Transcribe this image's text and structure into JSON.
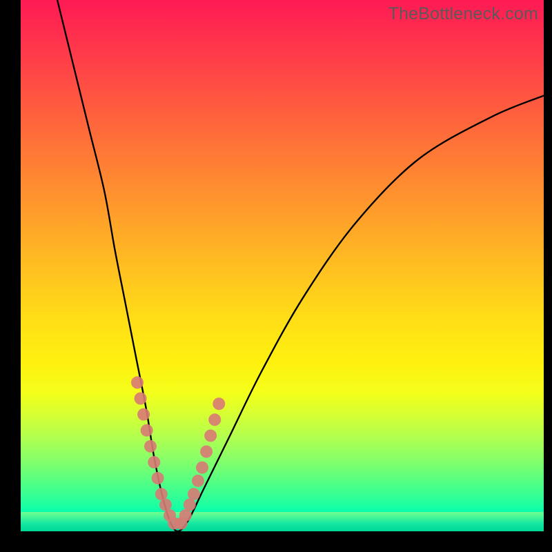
{
  "watermark": "TheBottleneck.com",
  "chart_data": {
    "type": "line",
    "title": "",
    "xlabel": "",
    "ylabel": "",
    "xlim": [
      0,
      100
    ],
    "ylim": [
      0,
      100
    ],
    "grid": false,
    "legend": false,
    "series": [
      {
        "name": "bottleneck-curve",
        "x": [
          7,
          10,
          13,
          16,
          18,
          20,
          22,
          24,
          25.5,
          27,
          28.5,
          30,
          32,
          35,
          40,
          46,
          54,
          64,
          76,
          90,
          100
        ],
        "y": [
          100,
          88,
          76,
          64,
          53,
          43,
          33,
          23,
          14,
          7,
          2,
          0,
          2,
          8,
          18,
          30,
          44,
          58,
          70,
          78,
          82
        ]
      }
    ],
    "markers": {
      "name": "highlight-points",
      "x": [
        22.3,
        22.9,
        23.5,
        24.1,
        24.8,
        25.5,
        26.2,
        26.9,
        27.7,
        28.5,
        29.3,
        30.7,
        31.5,
        32.3,
        33.1,
        33.9,
        34.7,
        35.5,
        36.3,
        37.1,
        37.9
      ],
      "y": [
        28,
        25,
        22,
        19,
        16,
        13,
        10,
        7,
        5,
        3,
        1.5,
        1.5,
        3,
        5,
        7,
        9.5,
        12,
        15,
        18,
        21,
        24
      ]
    },
    "background": {
      "type": "vertical-gradient",
      "stops": [
        {
          "pos": 0,
          "color": "#ff1a54"
        },
        {
          "pos": 50,
          "color": "#ffbe21"
        },
        {
          "pos": 78,
          "color": "#d6ff33"
        },
        {
          "pos": 100,
          "color": "#00e8a0"
        }
      ]
    }
  }
}
